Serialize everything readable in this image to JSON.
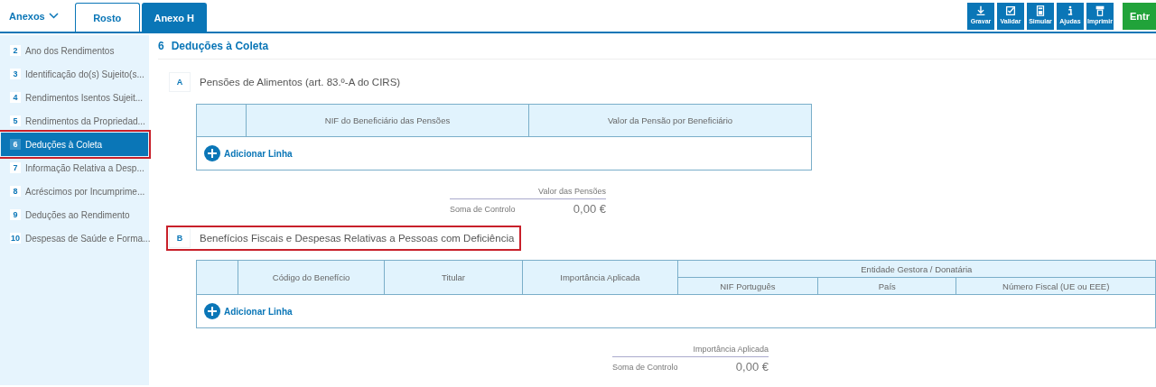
{
  "header": {
    "menu_label": "Anexos",
    "tabs": [
      {
        "label": "Rosto",
        "selected": false
      },
      {
        "label": "Anexo H",
        "selected": true
      }
    ],
    "toolbar": [
      {
        "label": "Gravar",
        "kind": "download"
      },
      {
        "label": "Validar",
        "kind": "check"
      },
      {
        "label": "Simular",
        "kind": "calculator"
      },
      {
        "label": "Ajudas",
        "kind": "info"
      },
      {
        "label": "Imprimir",
        "kind": "printer"
      }
    ],
    "submit_button": "Entr"
  },
  "sidebar": {
    "items": [
      {
        "number": "2",
        "label": "Ano dos Rendimentos",
        "selected": false,
        "highlighted": false
      },
      {
        "number": "3",
        "label": "Identificação do(s) Sujeito(s...",
        "selected": false,
        "highlighted": false
      },
      {
        "number": "4",
        "label": "Rendimentos Isentos Sujeit...",
        "selected": false,
        "highlighted": false
      },
      {
        "number": "5",
        "label": "Rendimentos da Propriedad...",
        "selected": false,
        "highlighted": false
      },
      {
        "number": "6",
        "label": "Deduções à Coleta",
        "selected": true,
        "highlighted": true
      },
      {
        "number": "7",
        "label": "Informação Relativa a Desp...",
        "selected": false,
        "highlighted": false
      },
      {
        "number": "8",
        "label": "Acréscimos por Incumprime...",
        "selected": false,
        "highlighted": false
      },
      {
        "number": "9",
        "label": "Deduções ao Rendimento",
        "selected": false,
        "highlighted": false
      },
      {
        "number": "10",
        "label": "Despesas de Saúde e Forma...",
        "selected": false,
        "highlighted": false
      }
    ]
  },
  "page": {
    "number": "6",
    "title": "Deduções à Coleta",
    "sections": [
      {
        "letter": "A",
        "title": "Pensões de Alimentos (art. 83.º-A do CIRS)",
        "highlighted": false,
        "kind": "simple",
        "columns": [
          "NIF do Beneficiário das Pensões",
          "Valor da Pensão por Beneficiário"
        ],
        "add_row": "Adicionar Linha",
        "sum": {
          "heading": "Valor das Pensões",
          "label": "Soma de Controlo",
          "value": "0,00 €"
        }
      },
      {
        "letter": "B",
        "title": "Benefícios Fiscais e Despesas Relativas a Pessoas com Deficiência",
        "highlighted": true,
        "kind": "grouped",
        "columns": [
          "Código do Benefício",
          "Titular",
          "Importância Aplicada"
        ],
        "group": {
          "heading": "Entidade Gestora / Donatária",
          "columns": [
            "NIF Português",
            "País",
            "Número Fiscal (UE ou EEE)"
          ]
        },
        "add_row": "Adicionar Linha",
        "sum": {
          "heading": "Importância Aplicada",
          "label": "Soma de Controlo",
          "value": "0,00 €"
        }
      }
    ]
  }
}
